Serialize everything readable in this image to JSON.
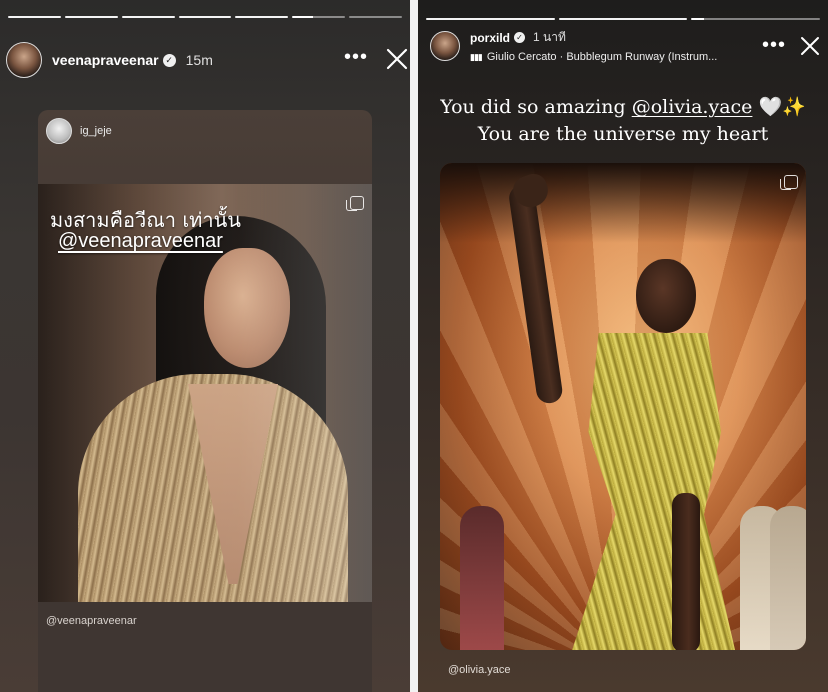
{
  "left_story": {
    "username": "veenapraveenar",
    "time": "15m",
    "more_label": "•••",
    "shared_post": {
      "author": "ig_jeje",
      "overlay_line1": "มงสามคือวีณา เท่านั้น",
      "overlay_line2": "@veenapraveenar",
      "caption_handle": "@veenapraveenar"
    },
    "progress": {
      "segments": 7,
      "completed": 5,
      "current_fraction": 0.4
    }
  },
  "right_story": {
    "username": "porxild",
    "time": "1 นาที",
    "music": "Giulio Cercato · Bubblegum Runway (Instrum...",
    "more_label": "•••",
    "caption_line1_prefix": "You did so amazing ",
    "caption_mention": "@olivia.yace",
    "caption_line1_suffix": " 🤍✨",
    "caption_line2": "You are the universe my heart",
    "post_caption_handle": "@olivia.yace",
    "progress": {
      "segments": 3,
      "completed": 2,
      "current_fraction": 0.1
    }
  },
  "colors": {
    "background": "#f2f2f2",
    "text": "#ffffff",
    "gown_gold": "#d8c956"
  },
  "icons": [
    "verified-badge-icon",
    "more-options-icon",
    "close-icon",
    "multiple-photos-icon",
    "music-bars-icon"
  ]
}
